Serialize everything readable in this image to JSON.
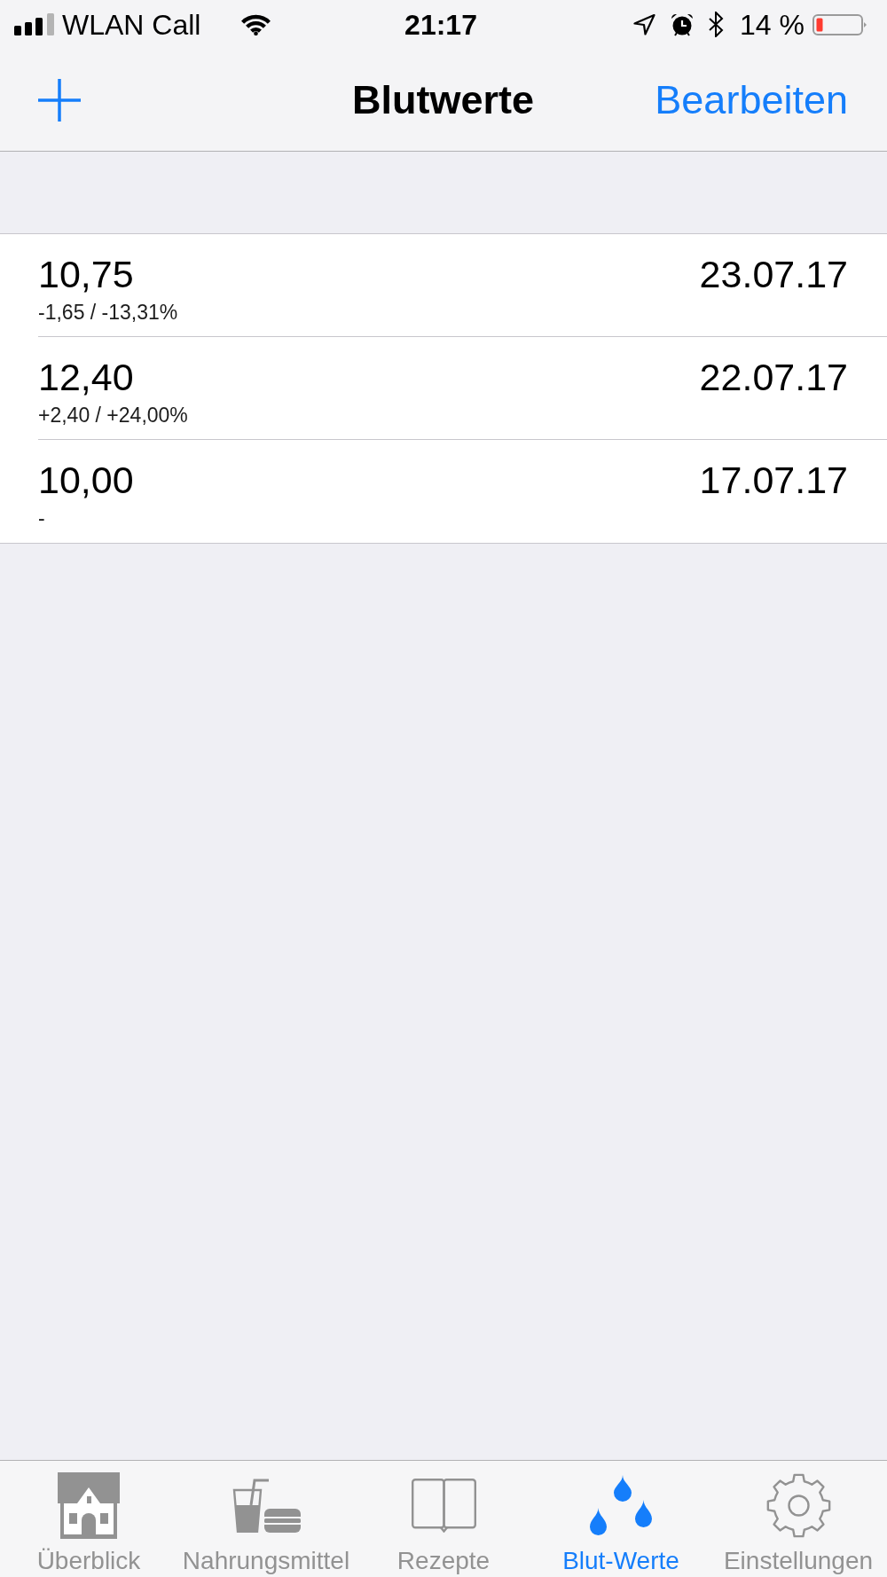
{
  "status_bar": {
    "carrier": "WLAN Call",
    "time": "21:17",
    "battery_percent": "14 %"
  },
  "nav_bar": {
    "title": "Blutwerte",
    "edit_button": "Bearbeiten"
  },
  "entries": [
    {
      "value": "10,75",
      "change": "-1,65 / -13,31%",
      "date": "23.07.17"
    },
    {
      "value": "12,40",
      "change": "+2,40 / +24,00%",
      "date": "22.07.17"
    },
    {
      "value": "10,00",
      "change": "-",
      "date": "17.07.17"
    }
  ],
  "tab_bar": {
    "tabs": [
      {
        "kind": "overview",
        "label": "Überblick",
        "selected": false
      },
      {
        "kind": "food",
        "label": "Nahrungsmittel",
        "selected": false
      },
      {
        "kind": "recipes",
        "label": "Rezepte",
        "selected": false
      },
      {
        "kind": "blood",
        "label": "Blut-Werte",
        "selected": true
      },
      {
        "kind": "settings",
        "label": "Einstellungen",
        "selected": false
      }
    ]
  }
}
